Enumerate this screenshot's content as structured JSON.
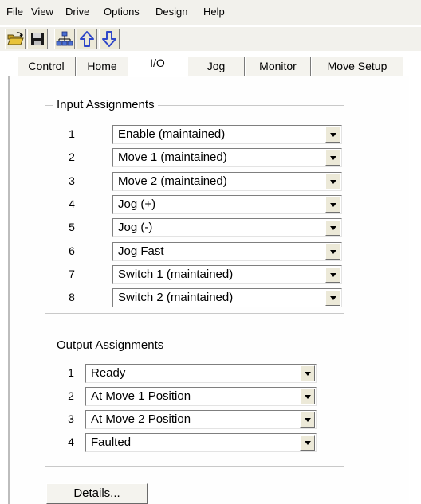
{
  "menu": {
    "file": "File",
    "view": "View",
    "drive": "Drive",
    "options": "Options",
    "design": "Design",
    "help": "Help"
  },
  "toolbar": {
    "icons": [
      "open-folder-icon",
      "save-icon",
      "network-icon",
      "upload-arrow-icon",
      "download-arrow-icon"
    ]
  },
  "tabs": {
    "control": "Control",
    "home": "Home",
    "io": "I/O",
    "jog": "Jog",
    "monitor": "Monitor",
    "move_setup": "Move Setup",
    "active": "I/O"
  },
  "inputs": {
    "title": "Input Assignments",
    "rows": [
      {
        "num": "1",
        "value": "Enable (maintained)"
      },
      {
        "num": "2",
        "value": "Move 1 (maintained)"
      },
      {
        "num": "3",
        "value": "Move 2 (maintained)"
      },
      {
        "num": "4",
        "value": "Jog (+)"
      },
      {
        "num": "5",
        "value": "Jog (-)"
      },
      {
        "num": "6",
        "value": "Jog Fast"
      },
      {
        "num": "7",
        "value": "Switch 1 (maintained)"
      },
      {
        "num": "8",
        "value": "Switch 2 (maintained)"
      }
    ]
  },
  "outputs": {
    "title": "Output Assignments",
    "rows": [
      {
        "num": "1",
        "value": "Ready"
      },
      {
        "num": "2",
        "value": "At Move 1 Position"
      },
      {
        "num": "3",
        "value": "At Move 2 Position"
      },
      {
        "num": "4",
        "value": "Faulted"
      }
    ]
  },
  "details_label": "Details...",
  "colors": {
    "icon_blue": "#2f47c8",
    "folder_yellow": "#e8c33a",
    "window_bg": "#f2f1ec"
  }
}
